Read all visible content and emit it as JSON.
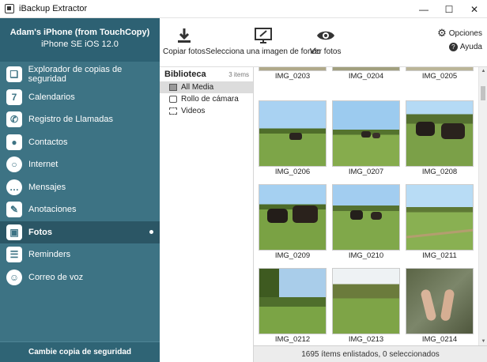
{
  "window": {
    "title": "iBackup Extractor"
  },
  "device": {
    "name": "Adam's iPhone (from TouchCopy)",
    "model": "iPhone SE iOS 12.0"
  },
  "sidebar": {
    "items": [
      {
        "label": "Explorador de copias de seguridad",
        "icon": "backup-explorer-icon"
      },
      {
        "label": "Calendarios",
        "icon": "calendar-icon"
      },
      {
        "label": "Registro de Llamadas",
        "icon": "phone-icon"
      },
      {
        "label": "Contactos",
        "icon": "contacts-icon"
      },
      {
        "label": "Internet",
        "icon": "internet-icon"
      },
      {
        "label": "Mensajes",
        "icon": "messages-icon"
      },
      {
        "label": "Anotaciones",
        "icon": "notes-icon"
      },
      {
        "label": "Fotos",
        "icon": "photos-icon",
        "active": true
      },
      {
        "label": "Reminders",
        "icon": "reminders-icon"
      },
      {
        "label": "Correo de voz",
        "icon": "voicemail-icon"
      }
    ],
    "footer": "Cambie copia de seguridad"
  },
  "toolbar": {
    "copy_photos": "Copiar fotos",
    "set_background": "Selecciona una imagen de fondo",
    "view_photos": "Ver fotos",
    "options": "Opciones",
    "help": "Ayuda"
  },
  "library": {
    "title": "Biblioteca",
    "count": "3 items",
    "items": [
      "All Media",
      "Rollo de cámara",
      "Videos"
    ]
  },
  "photos": [
    "IMG_0203",
    "IMG_0204",
    "IMG_0205",
    "IMG_0206",
    "IMG_0207",
    "IMG_0208",
    "IMG_0209",
    "IMG_0210",
    "IMG_0211",
    "IMG_0212",
    "IMG_0213",
    "IMG_0214"
  ],
  "status": "1695 ítems enlistados, 0 seleccionados",
  "colors": {
    "sidebar": "#3d7384",
    "sidebar_active": "#2b5665",
    "header": "#2d6173"
  }
}
